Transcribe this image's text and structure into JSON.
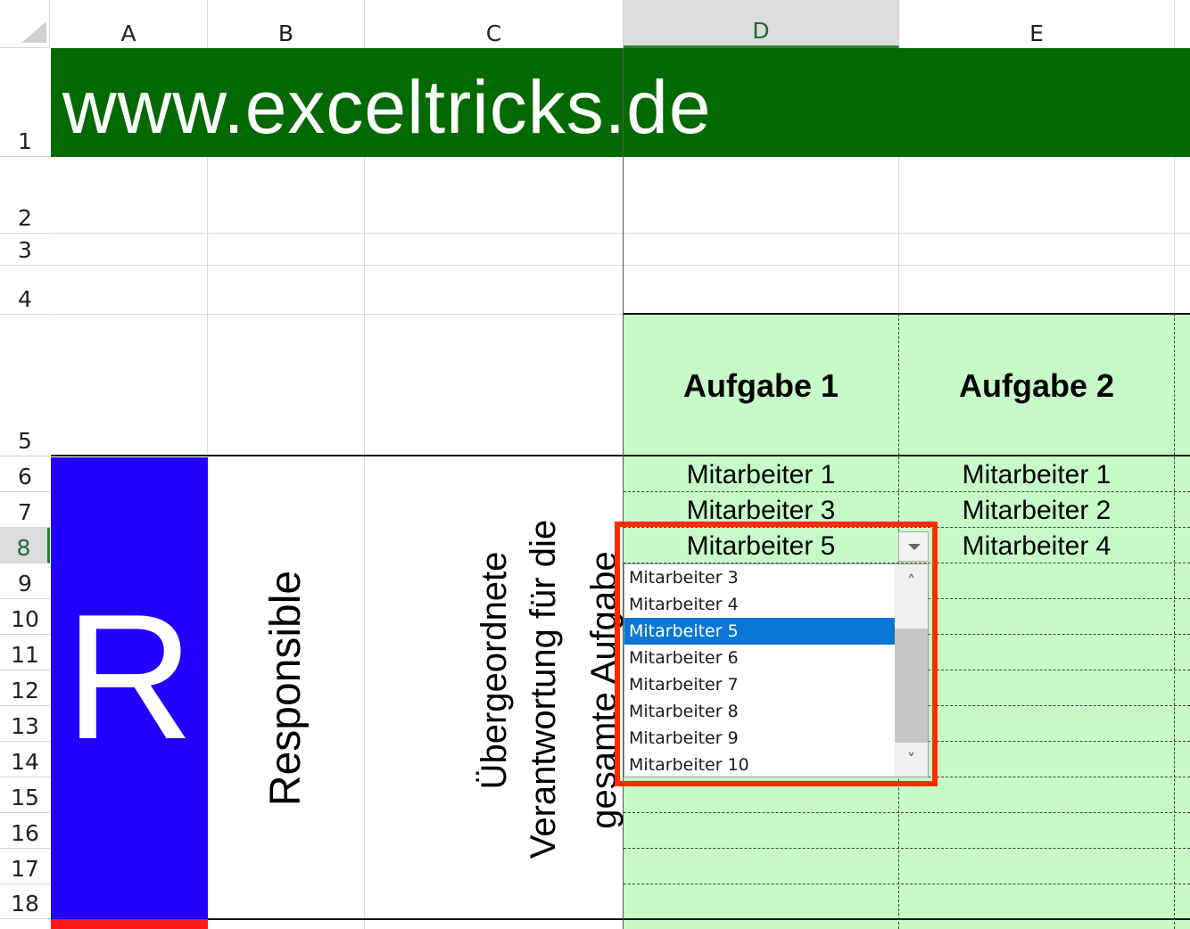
{
  "columns": [
    "A",
    "B",
    "C",
    "D",
    "E"
  ],
  "rows": [
    "1",
    "2",
    "3",
    "4",
    "5",
    "6",
    "7",
    "8",
    "9",
    "10",
    "11",
    "12",
    "13",
    "14",
    "15",
    "16",
    "17",
    "18"
  ],
  "active_column": "D",
  "active_row": "8",
  "title": "www.exceltricks.de",
  "tasks": [
    "Aufgabe 1",
    "Aufgabe 2"
  ],
  "column_d": [
    "Mitarbeiter 1",
    "Mitarbeiter 3",
    "Mitarbeiter 5"
  ],
  "column_e": [
    "Mitarbeiter 1",
    "Mitarbeiter 2",
    "Mitarbeiter 4"
  ],
  "role": {
    "letter": "R",
    "name": "Responsible",
    "description_line1": "Übergeordnete",
    "description_line2": "Verantwortung für die",
    "description_line3": "gesamte Aufgabe"
  },
  "dropdown": {
    "items": [
      "Mitarbeiter 3",
      "Mitarbeiter 4",
      "Mitarbeiter 5",
      "Mitarbeiter 6",
      "Mitarbeiter 7",
      "Mitarbeiter 8",
      "Mitarbeiter 9",
      "Mitarbeiter 10"
    ],
    "selected": "Mitarbeiter 5",
    "up_arrow": "˄",
    "down_arrow": "˅"
  },
  "colors": {
    "title_band": "#036a03",
    "task_fill": "#c6fac6",
    "r_block": "#2200ff",
    "next_block": "#ff1a1a",
    "highlight": "#ff2a00",
    "selection": "#0a76d6"
  },
  "icons": [
    "select-all-corner-icon",
    "dropdown-caret-icon",
    "scroll-up-icon",
    "scroll-down-icon"
  ]
}
